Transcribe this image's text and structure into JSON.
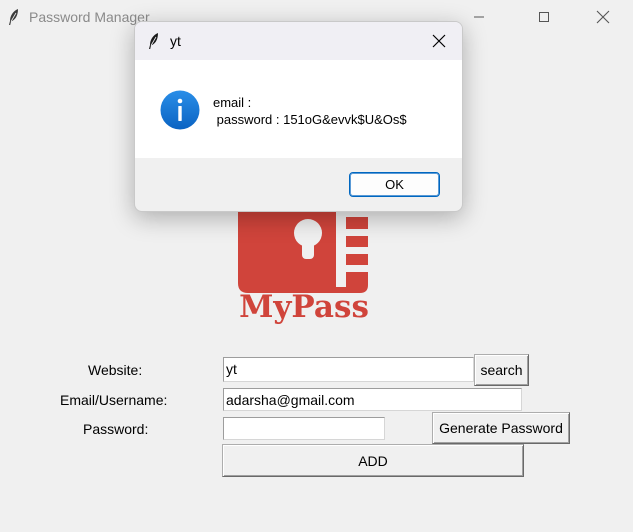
{
  "window": {
    "title": "Password Manager",
    "controls": [
      "minimize-icon",
      "maximize-icon",
      "close-icon"
    ]
  },
  "logo": {
    "text": "MyPass",
    "color": "#d0443b"
  },
  "form": {
    "website_label": "Website:",
    "website_value": "yt",
    "search_label": "search",
    "email_label": "Email/Username:",
    "email_value": "adarsha@gmail.com",
    "password_label": "Password:",
    "password_value": "",
    "generate_label": "Generate Password",
    "add_label": "ADD"
  },
  "dialog": {
    "title": "yt",
    "icon": "info-icon",
    "message": "email : \n password : 151oG&evvk$U&Os$",
    "ok_label": "OK",
    "accent": "#0067c0"
  }
}
